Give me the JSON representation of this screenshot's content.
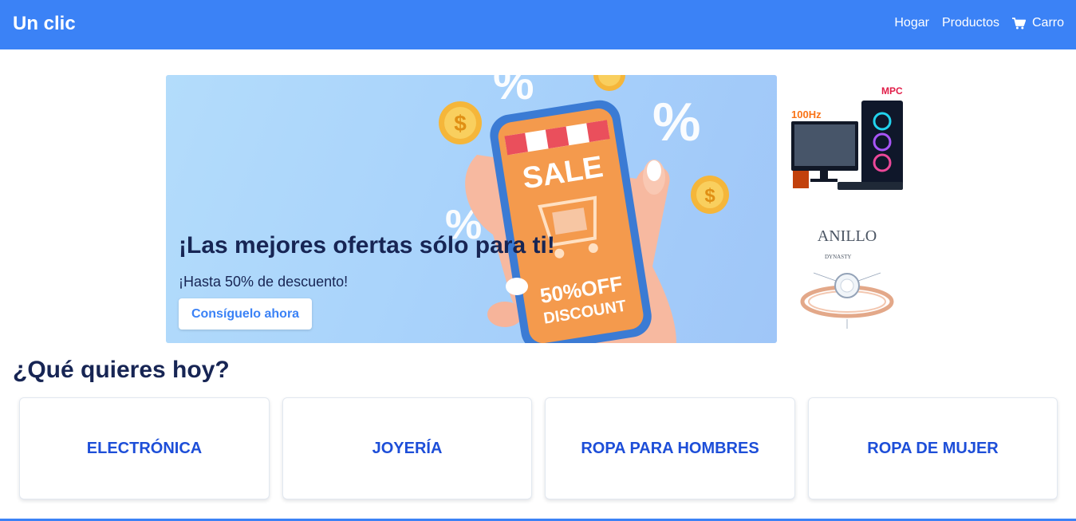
{
  "navbar": {
    "brand": "Un clic",
    "links": [
      {
        "label": "Hogar"
      },
      {
        "label": "Productos"
      },
      {
        "label": "Carro",
        "icon": "cart-icon"
      }
    ],
    "background": "#3b82f6"
  },
  "hero": {
    "title": "¡Las mejores ofertas sólo para ti!",
    "subtitle": "¡Hasta 50% de descuento!",
    "button_label": "Consíguelo ahora",
    "art_text": {
      "sale": "SALE",
      "off": "50%OFF",
      "discount": "DISCOUNT",
      "percent": "%"
    }
  },
  "side_images": [
    {
      "name": "gaming-pc-image",
      "badge": "MPC",
      "label": "100Hz"
    },
    {
      "name": "ring-image",
      "label": "ANILLO",
      "sublabel": "DYNASTY"
    }
  ],
  "categories_section": {
    "title": "¿Qué quieres hoy?",
    "items": [
      {
        "label": "ELECTRÓNICA"
      },
      {
        "label": "JOYERÍA"
      },
      {
        "label": "ROPA PARA HOMBRES"
      },
      {
        "label": "ROPA DE MUJER"
      }
    ]
  },
  "colors": {
    "primary": "#3b82f6",
    "heading": "#172554",
    "category_text": "#1d4ed8"
  }
}
